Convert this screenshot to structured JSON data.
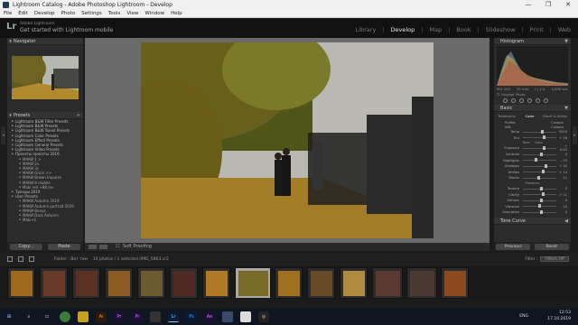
{
  "window": {
    "title": "Lightroom Catalog - Adobe Photoshop Lightroom - Develop",
    "controls": [
      "—",
      "❐",
      "✕"
    ]
  },
  "menu": [
    "File",
    "Edit",
    "Develop",
    "Photo",
    "Settings",
    "Tools",
    "View",
    "Window",
    "Help"
  ],
  "identity": {
    "logo": "Lr",
    "user": "Adobe Lightroom",
    "subtitle": "Get started with Lightroom mobile",
    "modules": [
      "Library",
      "Develop",
      "Map",
      "Book",
      "Slideshow",
      "Print",
      "Web"
    ],
    "active_module": "Develop"
  },
  "left_panel": {
    "navigator_label": "Navigator",
    "presets_label": "Presets",
    "presets": [
      {
        "label": "Lightroom B&W Filter Presets",
        "sub": false
      },
      {
        "label": "Lightroom B&W Presets",
        "sub": false
      },
      {
        "label": "Lightroom B&W Toned Presets",
        "sub": false
      },
      {
        "label": "Lightroom Color Presets",
        "sub": false
      },
      {
        "label": "Lightroom Effect Presets",
        "sub": false
      },
      {
        "label": "Lightroom General Presets",
        "sub": false
      },
      {
        "label": "Lightroom Video Presets",
        "sub": false
      },
      {
        "label": "Пресеты пресеты 2019",
        "sub": false
      },
      {
        "label": "МАКИ 1 >",
        "sub": true
      },
      {
        "label": "МАКИ 2н",
        "sub": true
      },
      {
        "label": "МАКИ 3с",
        "sub": true
      },
      {
        "label": "МАКИ Grain >>",
        "sub": true
      },
      {
        "label": "МАКИ Brown Impulse",
        "sub": true
      },
      {
        "label": "МАКИ 8 mobile",
        "sub": true
      },
      {
        "label": "Maki red +88 mv",
        "sub": true
      },
      {
        "label": "Тренды 2019",
        "sub": false
      },
      {
        "label": "User Presets",
        "sub": false
      },
      {
        "label": "МАКИ Autumn 2019",
        "sub": true
      },
      {
        "label": "МАКИ Autumn portrait 2019",
        "sub": true
      },
      {
        "label": "МАКИ Bonus",
        "sub": true
      },
      {
        "label": "МАКИ Dark Autumn",
        "sub": true
      },
      {
        "label": "Maki+1",
        "sub": true
      }
    ],
    "copy_button": "Copy...",
    "paste_button": "Paste"
  },
  "toolbar": {
    "soft_proofing": "Soft Proofing"
  },
  "right_panel": {
    "histogram_label": "Histogram",
    "hist_info": [
      "ISO 200",
      "35 mm",
      "f / 1.4",
      "1/500 sec"
    ],
    "original_photo": "Original Photo",
    "basic_label": "Basic",
    "profile_tabs": [
      "Treatment:",
      "Color",
      "Black & White"
    ],
    "profile_row": [
      "Profile:",
      "Custom"
    ],
    "wb_row": [
      "WB:",
      "Custom"
    ],
    "sliders_wb": [
      {
        "label": "Temp",
        "value": "5200",
        "pos": 0.55
      },
      {
        "label": "Tint",
        "value": "+ 16",
        "pos": 0.6
      }
    ],
    "tone_label": "Tone",
    "auto_label": "Auto",
    "sliders_tone": [
      {
        "label": "Exposure",
        "value": "+ 0.63",
        "pos": 0.6
      },
      {
        "label": "Contrast",
        "value": "0",
        "pos": 0.5
      },
      {
        "label": "Highlights",
        "value": "- 29",
        "pos": 0.36
      },
      {
        "label": "Shadows",
        "value": "+ 30",
        "pos": 0.64
      },
      {
        "label": "Whites",
        "value": "+ 14",
        "pos": 0.57
      },
      {
        "label": "Blacks",
        "value": "- 11",
        "pos": 0.44
      }
    ],
    "presence_label": "Presence",
    "sliders_presence": [
      {
        "label": "Texture",
        "value": "0",
        "pos": 0.5
      },
      {
        "label": "Clarity",
        "value": "+ 11",
        "pos": 0.56
      },
      {
        "label": "Dehaze",
        "value": "0",
        "pos": 0.5
      },
      {
        "label": "Vibrance",
        "value": "- 10",
        "pos": 0.45
      },
      {
        "label": "Saturation",
        "value": "0",
        "pos": 0.5
      }
    ],
    "tone_curve_label": "Tone Curve",
    "previous_button": "Previous",
    "reset_button": "Reset"
  },
  "filmstrip_bar": {
    "folder": "Folder : Вот там",
    "count": "14 photos / 1 selected /IMG_5863.cr2",
    "filter_label": "Filter :",
    "filter_value": "Filters Off"
  },
  "taskbar": {
    "lang": "ENG",
    "time": "12:53",
    "date": "17.10.2019"
  }
}
